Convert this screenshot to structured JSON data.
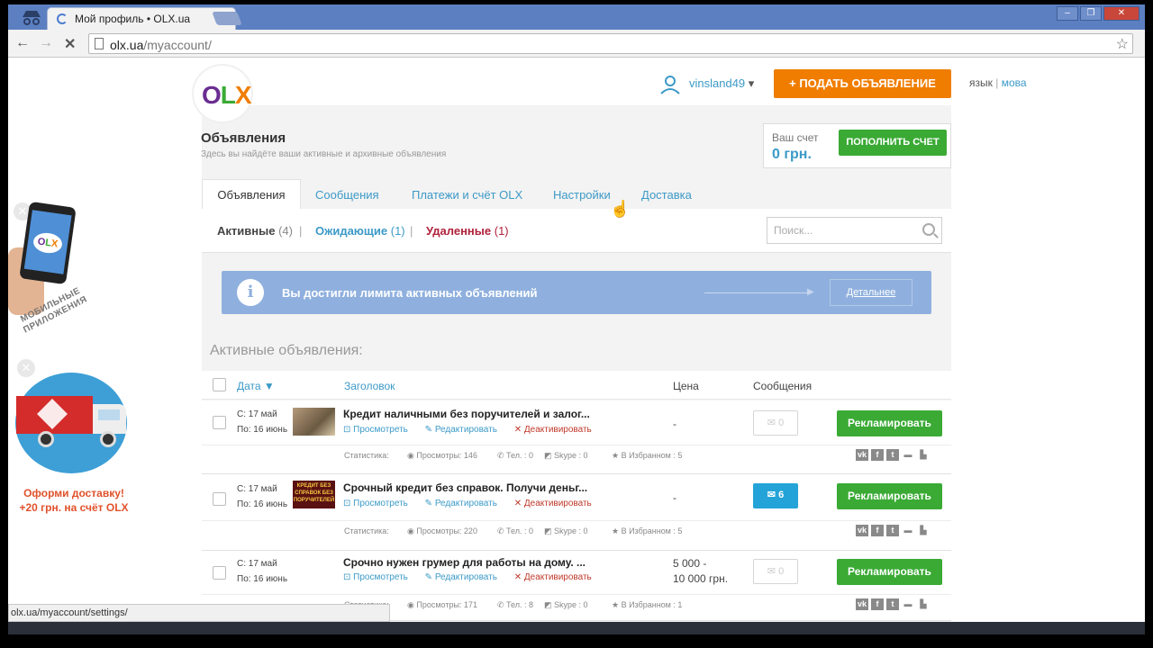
{
  "browser": {
    "tab_title": "Мой профиль • OLX.ua",
    "tab_close": "✕",
    "url_host": "olx.ua",
    "url_path": "/myaccount/",
    "status_url": "olx.ua/myaccount/settings/",
    "back": "←",
    "forward": "→",
    "stop": "✕",
    "star": "☆",
    "win_min": "–",
    "win_max": "❐",
    "win_close": "✕"
  },
  "header": {
    "logo": {
      "o": "O",
      "l": "L",
      "x": "X"
    },
    "username": "vinsland49",
    "dropdown": "▾",
    "post_button": "+ ПОДАТЬ ОБЪЯВЛЕНИЕ",
    "lang_label": "язык",
    "lang_sep": "|",
    "lang_option": "мова"
  },
  "page": {
    "title": "Объявления",
    "subtitle": "Здесь вы найдёте ваши активные и архивные объявления"
  },
  "account": {
    "label": "Ваш счет",
    "balance": "0 грн.",
    "topup_button": "ПОПОЛНИТЬ СЧЕТ"
  },
  "tabs": [
    "Объявления",
    "Сообщения",
    "Платежи и счёт OLX",
    "Настройки",
    "Доставка"
  ],
  "filters": {
    "active": "Активные",
    "active_count": "(4)",
    "pending": "Ожидающие",
    "pending_count": "(1)",
    "deleted": "Удаленные",
    "deleted_count": "(1)",
    "sep": "|"
  },
  "search": {
    "placeholder": "Поиск..."
  },
  "notice": {
    "icon": "i",
    "text": "Вы достигли лимита активных объявлений",
    "button": "Детальнее"
  },
  "section_title": "Активные объявления:",
  "table": {
    "headers": {
      "date": "Дата",
      "title": "Заголовок",
      "price": "Цена",
      "messages": "Сообщения"
    },
    "sort_icon": "▼",
    "rows": [
      {
        "from": "С: 17 май",
        "to": "По: 16 июнь",
        "title": "Кредит наличными без поручителей и залог...",
        "view": "Просмотреть",
        "edit": "Редактировать",
        "deactivate": "Деактивировать",
        "price_1": "-",
        "price_2": "",
        "messages": "0",
        "promote": "Рекламировать",
        "stats_label": "Статистика:",
        "views": "Просмотры: 146",
        "phone": "Тел. : 0",
        "skype": "Skype : 0",
        "favorites": "В Избранном : 5"
      },
      {
        "from": "С: 17 май",
        "to": "По: 16 июнь",
        "title": "Срочный кредит без справок. Получи деньг...",
        "view": "Просмотреть",
        "edit": "Редактировать",
        "deactivate": "Деактивировать",
        "price_1": "-",
        "price_2": "",
        "messages": "6",
        "promote": "Рекламировать",
        "stats_label": "Статистика:",
        "views": "Просмотры: 220",
        "phone": "Тел. : 0",
        "skype": "Skype : 0",
        "favorites": "В Избранном : 5",
        "thumb_text": "КРЕДИТ БЕЗ СПРАВОК БЕЗ ПОРУЧИТЕЛЕЙ"
      },
      {
        "from": "С: 17 май",
        "to": "По: 16 июнь",
        "title": "Срочно нужен грумер для работы на дому. ...",
        "view": "Просмотреть",
        "edit": "Редактировать",
        "deactivate": "Деактивировать",
        "price_1": "5 000 -",
        "price_2": "10 000 грн.",
        "messages": "0",
        "promote": "Рекламировать",
        "stats_label": "Статистика:",
        "views": "Просмотры: 171",
        "phone": "Тел. : 8",
        "skype": "Skype : 0",
        "favorites": "В Избранном : 1"
      }
    ],
    "social": {
      "vk": "vk",
      "fb": "f",
      "tw": "t"
    }
  },
  "ads": {
    "close": "✕",
    "apps_text": "МОБИЛЬНЫЕ ПРИЛОЖЕНИЯ",
    "delivery_text_1": "Оформи доставку!",
    "delivery_text_2": "+20 грн. на счёт OLX"
  },
  "colors": {
    "orange": "#f07d00",
    "green": "#3aaa35",
    "link_blue": "#3c9ac7",
    "notice_blue": "#8fb0de",
    "msg_blue": "#24a3d8"
  }
}
